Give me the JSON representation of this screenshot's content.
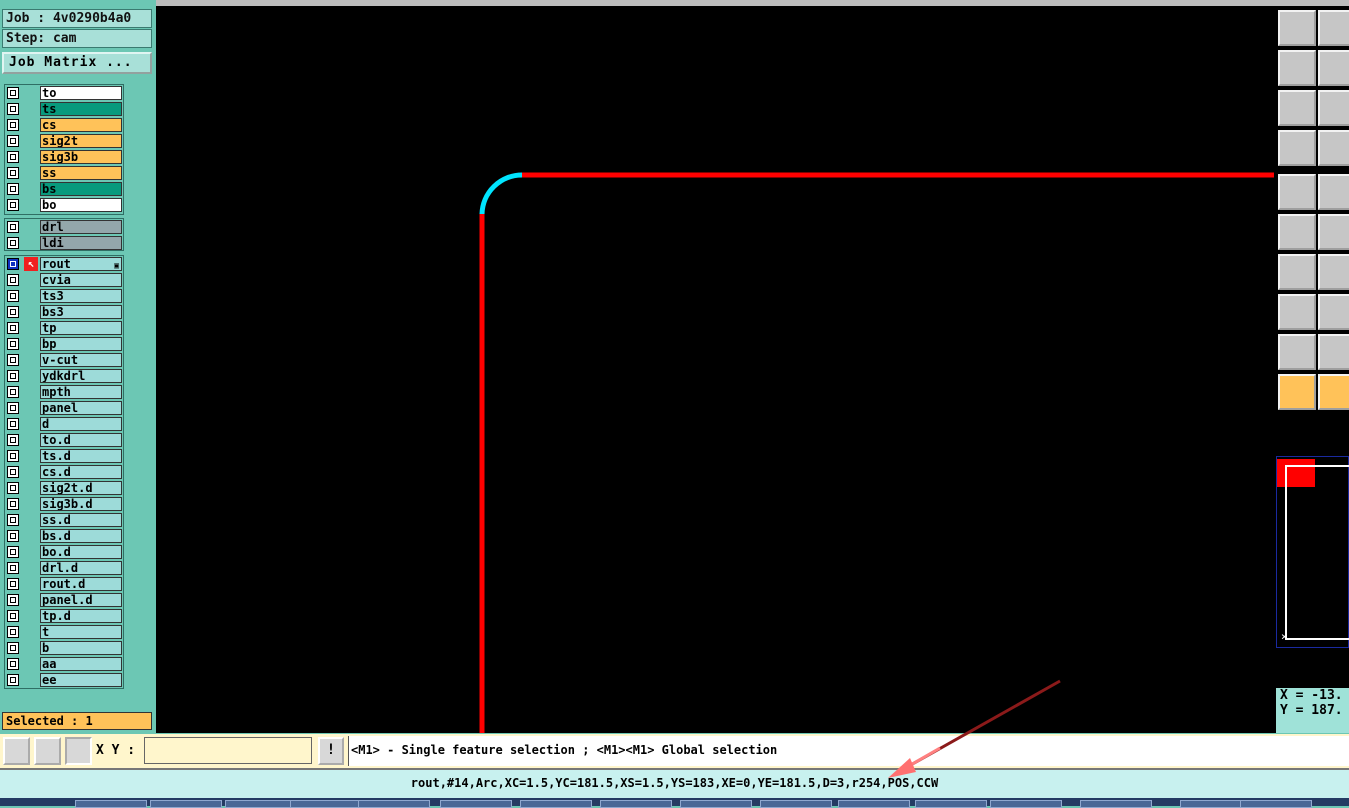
{
  "job": {
    "label": "Job : 4v0290b4a0",
    "step": "Step: cam",
    "matrix_button": "Job Matrix ..."
  },
  "layers_signal": [
    {
      "name": "to",
      "color": "white"
    },
    {
      "name": "ts",
      "color": "green"
    },
    {
      "name": "cs",
      "color": "orange"
    },
    {
      "name": "sig2t",
      "color": "orange"
    },
    {
      "name": "sig3b",
      "color": "orange"
    },
    {
      "name": "ss",
      "color": "orange"
    },
    {
      "name": "bs",
      "color": "green"
    },
    {
      "name": "bo",
      "color": "white"
    }
  ],
  "layers_drill": [
    {
      "name": "drl",
      "color": "gray"
    },
    {
      "name": "ldi",
      "color": "gray"
    }
  ],
  "layers_other": [
    {
      "name": "rout",
      "color": "cyan",
      "selected": true
    },
    {
      "name": "cvia"
    },
    {
      "name": "ts3"
    },
    {
      "name": "bs3"
    },
    {
      "name": "tp"
    },
    {
      "name": "bp"
    },
    {
      "name": "v-cut"
    },
    {
      "name": "ydkdrl"
    },
    {
      "name": "mpth"
    },
    {
      "name": "panel"
    },
    {
      "name": "d"
    },
    {
      "name": "to.d"
    },
    {
      "name": "ts.d"
    },
    {
      "name": "cs.d"
    },
    {
      "name": "sig2t.d"
    },
    {
      "name": "sig3b.d"
    },
    {
      "name": "ss.d"
    },
    {
      "name": "bs.d"
    },
    {
      "name": "bo.d"
    },
    {
      "name": "drl.d"
    },
    {
      "name": "rout.d"
    },
    {
      "name": "panel.d"
    },
    {
      "name": "tp.d"
    },
    {
      "name": "t"
    },
    {
      "name": "b"
    },
    {
      "name": "aa"
    },
    {
      "name": "ee"
    }
  ],
  "layer_colors": {
    "white": "#ffffff",
    "green": "#089a7d",
    "orange": "#ffc259",
    "gray": "#93a7ab",
    "cyan": "#9ddbd9"
  },
  "selected_count": "Selected : 1",
  "canvas": {
    "line_color": "#ff0000",
    "arc_color": "#00e5ff"
  },
  "toolbar": {
    "icons": [
      "layer-up-icon",
      "layer-down-icon",
      "left-icon",
      "right-icon",
      "fit-icon",
      "zoom-area-icon",
      "tools-icon",
      "connect-icon",
      "feature-select-icon",
      "edit-icon",
      "node-icon",
      "cross-icon",
      "angle-icon",
      "slope-icon",
      "pad-icon",
      "line-icon",
      "triangle-icon",
      "peak-icon",
      "pointer-select-icon",
      "pointer-area-icon"
    ]
  },
  "coords": {
    "x": "X = -13.",
    "y": "Y = 187."
  },
  "command": {
    "xy_label": "X Y :",
    "xy_value": "",
    "message": "<M1> - Single feature selection ; <M1><M1> Global selection"
  },
  "status": "rout,#14,Arc,XC=1.5,YC=181.5,XS=1.5,YS=183,XE=0,YE=181.5,D=3,r254,POS,CCW"
}
